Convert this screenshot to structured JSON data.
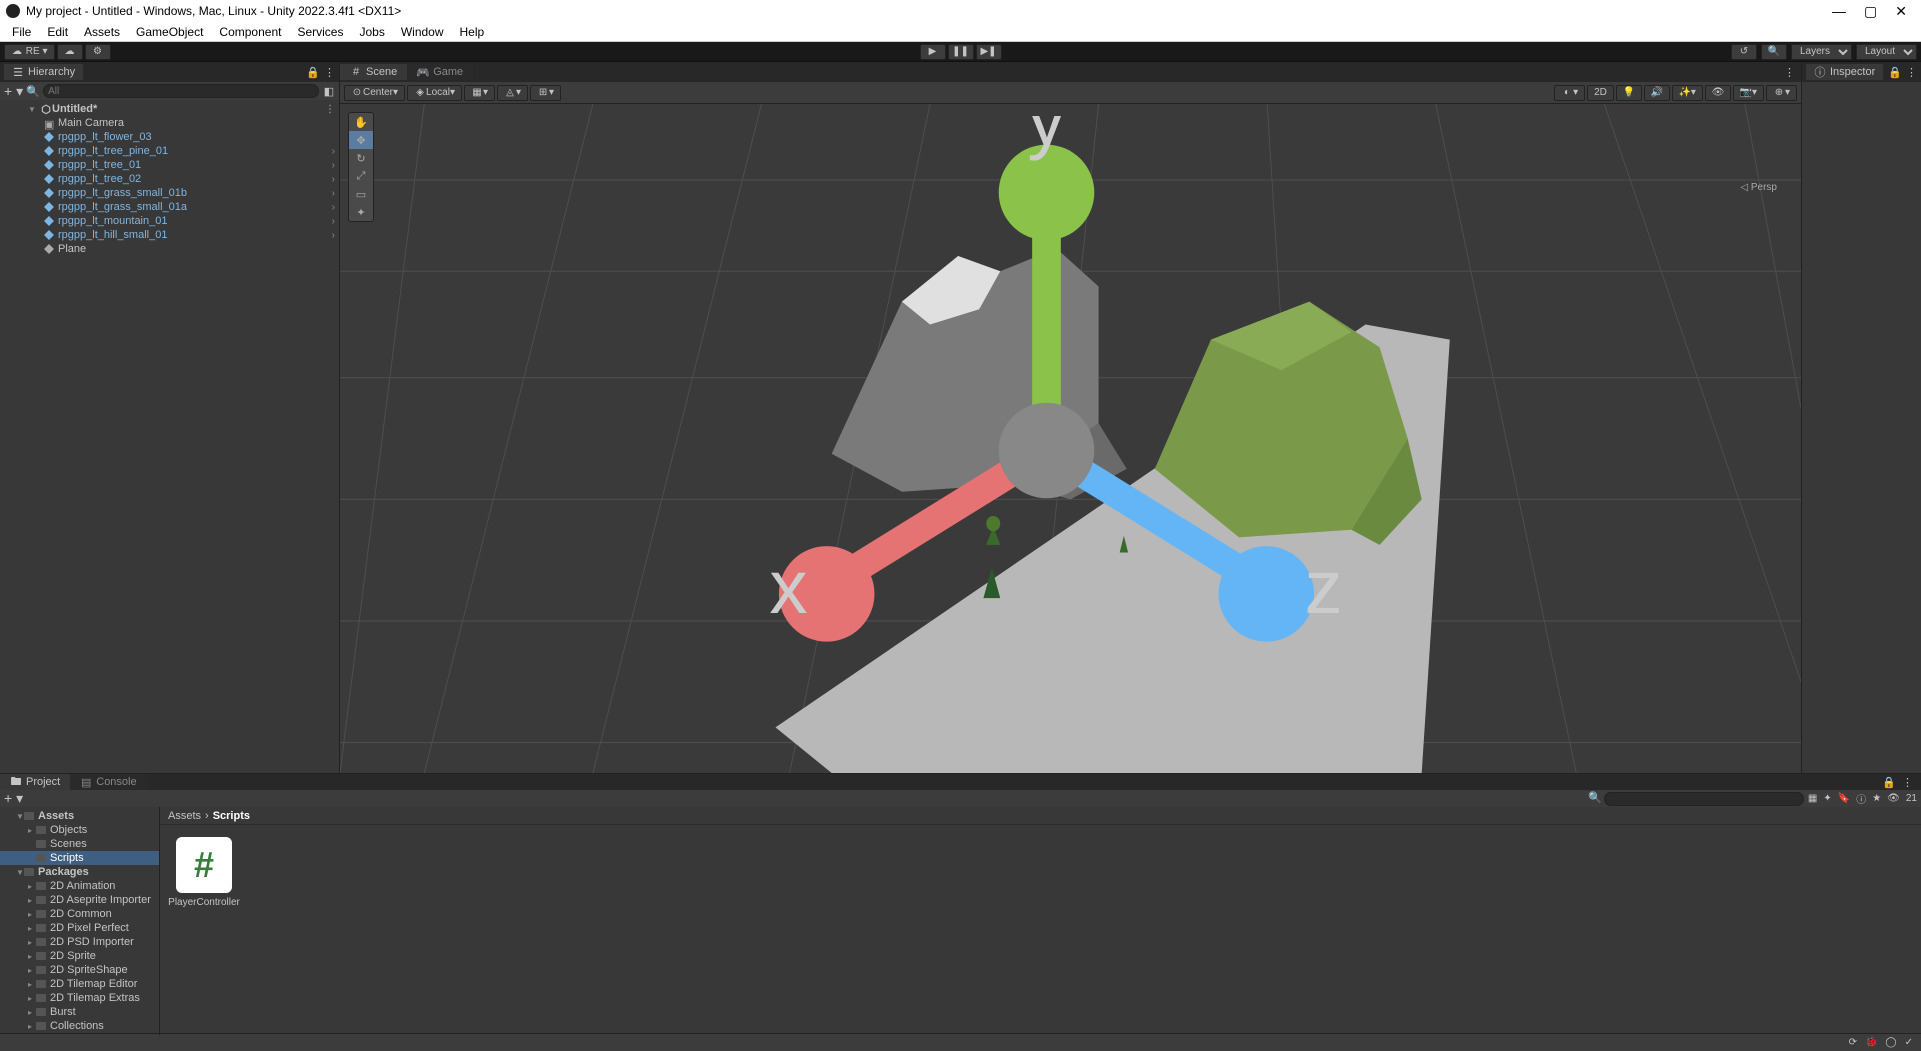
{
  "title": "My project - Untitled - Windows, Mac, Linux - Unity 2022.3.4f1 <DX11>",
  "menu": [
    "File",
    "Edit",
    "Assets",
    "GameObject",
    "Component",
    "Services",
    "Jobs",
    "Window",
    "Help"
  ],
  "toolbar": {
    "account_label": "RE",
    "layers_label": "Layers",
    "layout_label": "Layout"
  },
  "panels": {
    "hierarchy": "Hierarchy",
    "scene": "Scene",
    "game": "Game",
    "inspector": "Inspector",
    "project": "Project",
    "console": "Console"
  },
  "hierarchy": {
    "search_placeholder": "All",
    "root": "Untitled*",
    "items": [
      {
        "name": "Main Camera",
        "prefab": false
      },
      {
        "name": "rpgpp_lt_flower_03",
        "prefab": true
      },
      {
        "name": "rpgpp_lt_tree_pine_01",
        "prefab": true
      },
      {
        "name": "rpgpp_lt_tree_01",
        "prefab": true
      },
      {
        "name": "rpgpp_lt_tree_02",
        "prefab": true
      },
      {
        "name": "rpgpp_lt_grass_small_01b",
        "prefab": true
      },
      {
        "name": "rpgpp_lt_grass_small_01a",
        "prefab": true
      },
      {
        "name": "rpgpp_lt_mountain_01",
        "prefab": true
      },
      {
        "name": "rpgpp_lt_hill_small_01",
        "prefab": true
      },
      {
        "name": "Plane",
        "prefab": false
      }
    ]
  },
  "scene_toolbar": {
    "pivot": "Center",
    "handle": "Local",
    "mode_2d": "2D"
  },
  "gizmo": {
    "x": "x",
    "y": "y",
    "z": "z",
    "persp": "Persp"
  },
  "project": {
    "breadcrumb": [
      "Assets",
      "Scripts"
    ],
    "tree": {
      "assets": "Assets",
      "assets_children": [
        "Objects",
        "Scenes",
        "Scripts"
      ],
      "packages": "Packages",
      "packages_children": [
        "2D Animation",
        "2D Aseprite Importer",
        "2D Common",
        "2D Pixel Perfect",
        "2D PSD Importer",
        "2D Sprite",
        "2D SpriteShape",
        "2D Tilemap Editor",
        "2D Tilemap Extras",
        "Burst",
        "Collections"
      ]
    },
    "files": [
      {
        "name": "PlayerController",
        "glyph": "#"
      }
    ],
    "hidden_count": "21"
  }
}
